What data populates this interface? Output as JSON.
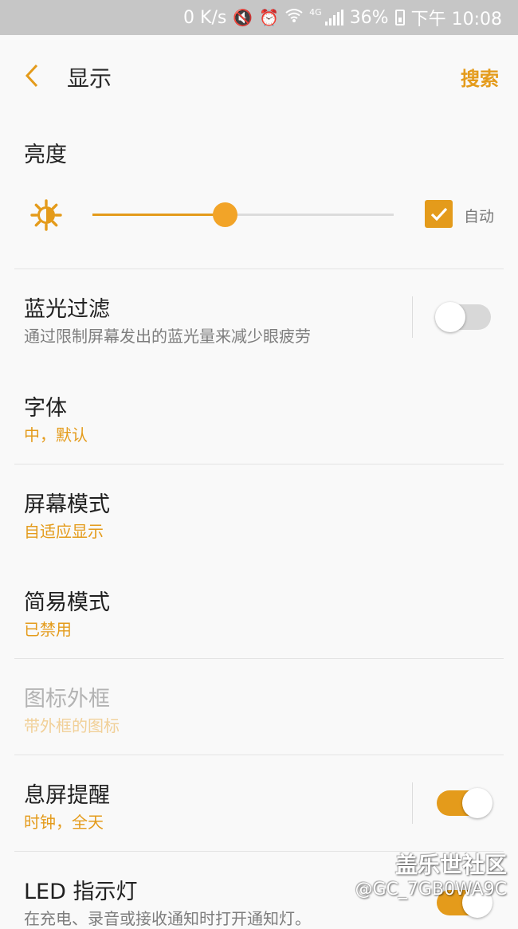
{
  "status_bar": {
    "net_speed": "0 K/s",
    "network_type": "4G",
    "battery": "36%",
    "time": "下午 10:08",
    "icons": [
      "mute-icon",
      "alarm-icon",
      "wifi-icon",
      "signal-icon",
      "battery-charging-icon"
    ]
  },
  "header": {
    "back_icon": "chevron-left-icon",
    "title": "显示",
    "search_label": "搜索"
  },
  "brightness": {
    "title": "亮度",
    "icon": "sun-icon",
    "level": 0.44,
    "auto_label": "自动",
    "auto_checked": true
  },
  "items": {
    "blue_light": {
      "title": "蓝光过滤",
      "subtitle": "通过限制屏幕发出的蓝光量来减少眼疲劳",
      "enabled": false
    },
    "font": {
      "title": "字体",
      "subtitle": "中，默认"
    },
    "screen_mode": {
      "title": "屏幕模式",
      "subtitle": "自适应显示"
    },
    "easy_mode": {
      "title": "简易模式",
      "subtitle": "已禁用"
    },
    "icon_frame": {
      "title": "图标外框",
      "subtitle": "带外框的图标"
    },
    "always_on": {
      "title": "息屏提醒",
      "subtitle": "时钟，全天",
      "enabled": true
    },
    "led": {
      "title": "LED 指示灯",
      "subtitle": "在充电、录音或接收通知时打开通知灯。",
      "enabled": true
    }
  },
  "watermark": {
    "brand": "盖乐世社区",
    "user": "@GC_7GB0WA9C"
  },
  "colors": {
    "accent": "#e49b1b",
    "background": "#f9f9f9",
    "status_bar": "#c6c6c6"
  }
}
